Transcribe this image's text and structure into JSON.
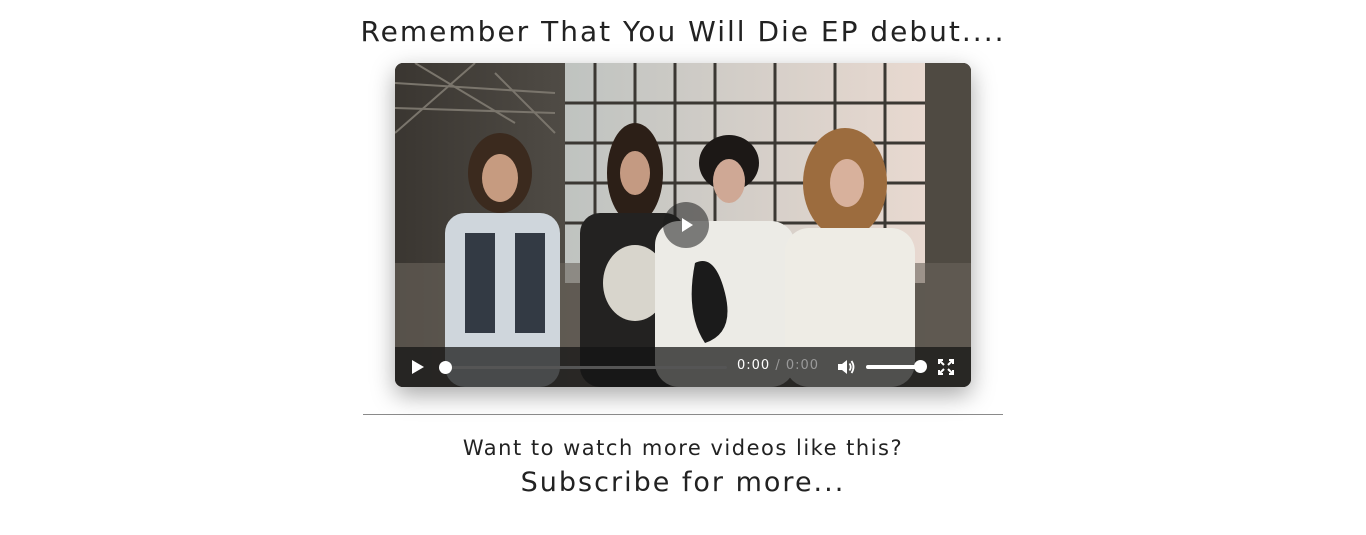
{
  "page": {
    "title": "Remember That You Will Die EP debut....",
    "prompt": "Want to watch more videos like this?",
    "subscribe_label": "Subscribe for more..."
  },
  "player": {
    "poster_description_icon": "band-photo",
    "current_time": "0:00",
    "time_separator": "/",
    "duration": "0:00",
    "progress": 0,
    "volume": 1.0,
    "icons": {
      "big_play": "play-icon",
      "play": "play-icon",
      "volume": "volume-icon",
      "fullscreen": "fullscreen-icon"
    }
  },
  "colors": {
    "text": "#222222",
    "divider": "#8a8a8a",
    "control_bar": "#141414"
  }
}
